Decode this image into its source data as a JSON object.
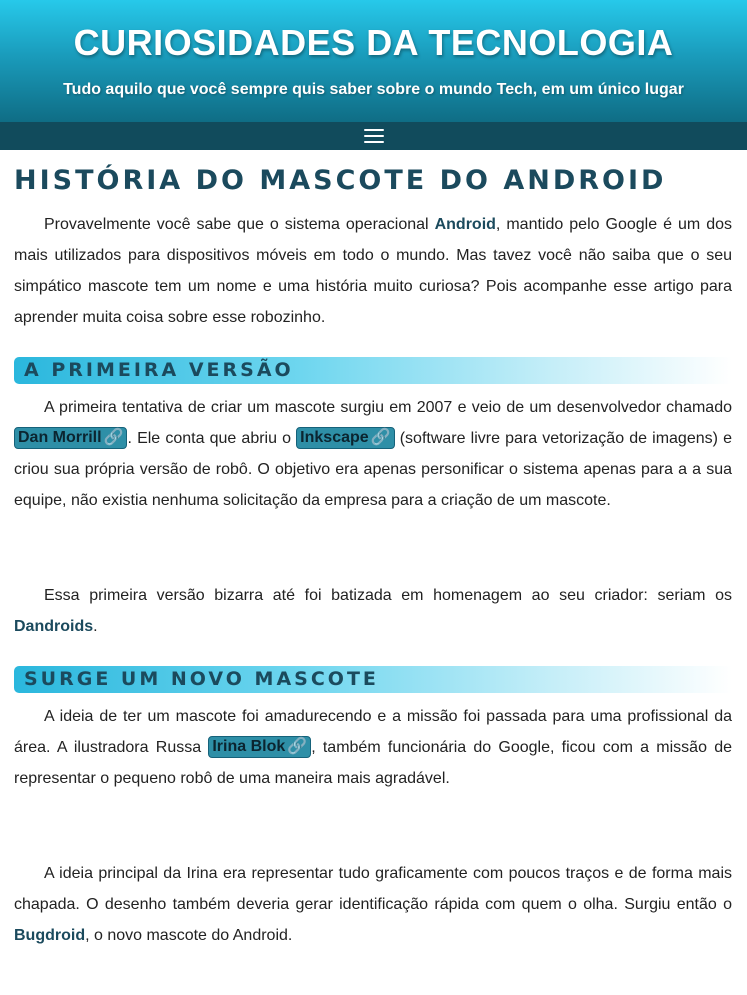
{
  "header": {
    "site_title": "CURIOSIDADES DA TECNOLOGIA",
    "tagline": "Tudo aquilo que você sempre quis saber sobre o mundo Tech, em um único lugar"
  },
  "nav": {
    "menu_icon": "hamburger-menu-icon"
  },
  "article": {
    "title": "História do mascote do Android",
    "intro": {
      "t1": "Provavelmente você sabe que o sistema operacional ",
      "android": "Android",
      "t2": ", mantido pelo Google é um dos mais utilizados para dispositivos móveis em todo o mundo. Mas tavez você não saiba que o seu simpático mascote tem um nome e uma história muito curiosa? Pois acompanhe esse artigo para aprender muita coisa sobre esse robozinho."
    },
    "section1": {
      "heading": "A primeira versão",
      "p1": {
        "t1": "A primeira tentativa de criar um mascote surgiu em 2007 e veio de um desenvolvedor chamado ",
        "link1": "Dan Morrill",
        "t2": ". Ele conta que abriu o ",
        "link2": "Inkscape",
        "t3": " (software livre para vetorização de imagens) e criou sua própria versão de robô. O objetivo era apenas personificar o sistema apenas para a a sua equipe, não existia nenhuma solicitação da empresa para a criação de um mascote."
      },
      "p2": {
        "t1": "Essa primeira versão bizarra até foi batizada em homenagem ao seu criador: seriam os ",
        "dandroids": "Dandroids",
        "t2": "."
      }
    },
    "section2": {
      "heading": "Surge um novo mascote",
      "p1": {
        "t1": "A ideia de ter um mascote foi amadurecendo e a missão foi passada para uma profissional da área. A ilustradora Russa ",
        "link": "Irina Blok",
        "t2": ", também funcionária do Google, ficou com a missão de representar o pequeno robô de uma maneira mais agradável."
      },
      "p2": {
        "t1": "A ideia principal da Irina era representar tudo graficamente com poucos traços e de forma mais chapada. O desenho também deveria gerar identificação rápida com quem o olha. Surgiu então o ",
        "bugdroid": "Bugdroid",
        "t2": ", o novo mascote do Android."
      }
    },
    "link_icon": "chain-link-icon",
    "link_glyph": "🔗"
  },
  "colors": {
    "header_top": "#27c9ea",
    "header_bottom": "#0f6d85",
    "navbar": "#114b5c",
    "heading_text": "#1b4a5d",
    "link_pill": "#2e8fa7"
  }
}
